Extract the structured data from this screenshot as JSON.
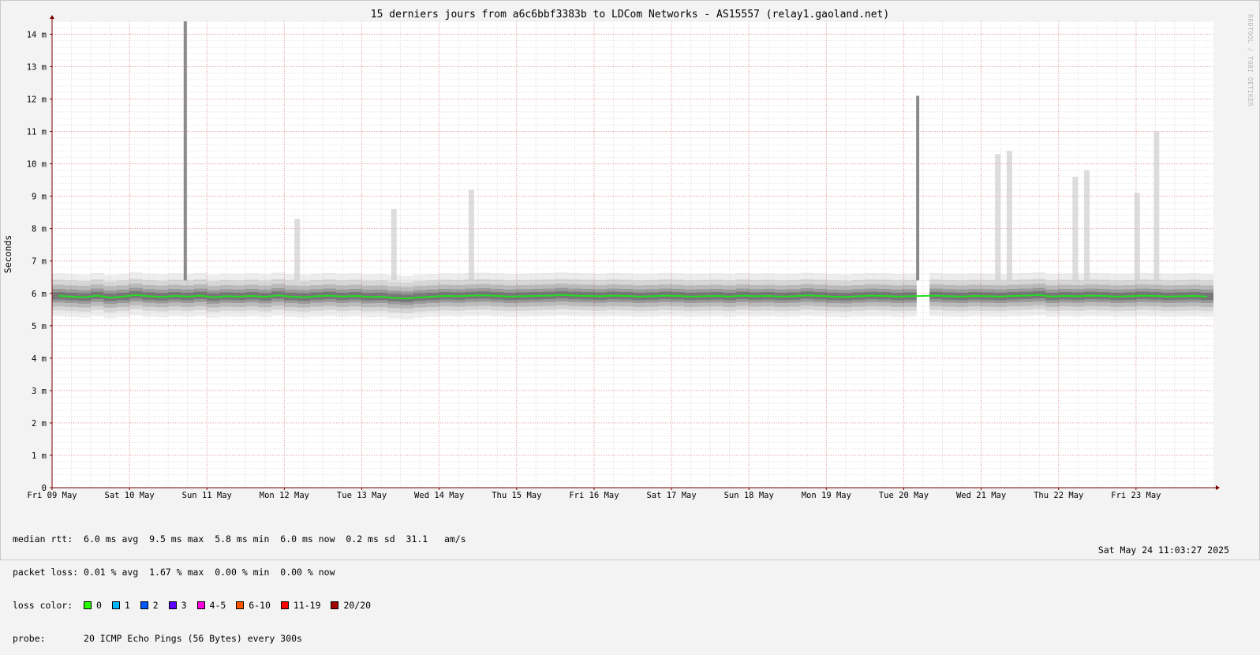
{
  "chart_data": {
    "type": "area",
    "title": "15 derniers jours from a6c6bbf3383b to LDCom Networks - AS15557 (relay1.gaoland.net)",
    "ylabel": "Seconds",
    "xlabel": "",
    "ylim": [
      0,
      14.4
    ],
    "y_unit_label": "ms",
    "y_ticks": [
      {
        "value": 0,
        "label": "0"
      },
      {
        "value": 1,
        "label": "1 m"
      },
      {
        "value": 2,
        "label": "2 m"
      },
      {
        "value": 3,
        "label": "3 m"
      },
      {
        "value": 4,
        "label": "4 m"
      },
      {
        "value": 5,
        "label": "5 m"
      },
      {
        "value": 6,
        "label": "6 m"
      },
      {
        "value": 7,
        "label": "7 m"
      },
      {
        "value": 8,
        "label": "8 m"
      },
      {
        "value": 9,
        "label": "9 m"
      },
      {
        "value": 10,
        "label": "10 m"
      },
      {
        "value": 11,
        "label": "11 m"
      },
      {
        "value": 12,
        "label": "12 m"
      },
      {
        "value": 13,
        "label": "13 m"
      },
      {
        "value": 14,
        "label": "14 m"
      }
    ],
    "x_range": [
      "2025-05-09",
      "2025-05-24 00:00"
    ],
    "x_ticks": [
      {
        "day": 0,
        "label": "Fri 09 May"
      },
      {
        "day": 1,
        "label": "Sat 10 May"
      },
      {
        "day": 2,
        "label": "Sun 11 May"
      },
      {
        "day": 3,
        "label": "Mon 12 May"
      },
      {
        "day": 4,
        "label": "Tue 13 May"
      },
      {
        "day": 5,
        "label": "Wed 14 May"
      },
      {
        "day": 6,
        "label": "Thu 15 May"
      },
      {
        "day": 7,
        "label": "Fri 16 May"
      },
      {
        "day": 8,
        "label": "Sat 17 May"
      },
      {
        "day": 9,
        "label": "Sun 18 May"
      },
      {
        "day": 10,
        "label": "Mon 19 May"
      },
      {
        "day": 11,
        "label": "Tue 20 May"
      },
      {
        "day": 12,
        "label": "Wed 21 May"
      },
      {
        "day": 13,
        "label": "Thu 22 May"
      },
      {
        "day": 14,
        "label": "Fri 23 May"
      }
    ],
    "series_name": "median rtt",
    "median_ms": [
      5.92,
      5.9,
      5.88,
      5.93,
      5.87,
      5.9,
      5.95,
      5.91,
      5.89,
      5.92,
      5.9,
      5.93,
      5.88,
      5.91,
      5.9,
      5.92,
      5.89,
      5.94,
      5.9,
      5.88,
      5.91,
      5.93,
      5.9,
      5.92,
      5.89,
      5.9,
      5.86,
      5.84,
      5.88,
      5.9,
      5.92,
      5.91,
      5.93,
      5.94,
      5.92,
      5.9,
      5.91,
      5.92,
      5.93,
      5.95,
      5.93,
      5.92,
      5.91,
      5.93,
      5.92,
      5.9,
      5.91,
      5.93,
      5.92,
      5.9,
      5.91,
      5.92,
      5.9,
      5.93,
      5.91,
      5.92,
      5.9,
      5.91,
      5.94,
      5.92,
      5.9,
      5.89,
      5.91,
      5.93,
      5.92,
      5.9,
      5.91,
      5.92,
      5.93,
      5.91,
      5.9,
      5.92,
      5.91,
      5.9,
      5.92,
      5.93,
      5.95,
      5.9,
      5.92,
      5.91,
      5.93,
      5.92,
      5.9,
      5.91,
      5.93,
      5.92,
      5.9,
      5.91,
      5.92,
      5.9
    ],
    "spikes_ms": [
      {
        "day": 1.72,
        "max": 14.4
      },
      {
        "day": 11.18,
        "max": 12.1
      },
      {
        "day": 5.4,
        "max": 9.2
      },
      {
        "day": 4.4,
        "max": 8.6
      },
      {
        "day": 3.15,
        "max": 8.3
      },
      {
        "day": 12.2,
        "max": 10.3
      },
      {
        "day": 12.35,
        "max": 10.4
      },
      {
        "day": 13.2,
        "max": 9.6
      },
      {
        "day": 13.35,
        "max": 9.8
      },
      {
        "day": 14.0,
        "max": 9.1
      },
      {
        "day": 14.25,
        "max": 11.0
      }
    ],
    "outage_day": 11.2,
    "colors": {
      "background": "#ffffff",
      "grid_minor": "#e6e6e6",
      "grid_major": "#f1a0a0",
      "axis": "#7a0000",
      "median": "#22dd22",
      "smoke": "#505050"
    }
  },
  "stats": {
    "median_rtt_label": "median rtt:",
    "median_rtt_text": "6.0 ms avg  9.5 ms max  5.8 ms min  6.0 ms now  0.2 ms sd  31.1   am/s",
    "packet_loss_label": "packet loss:",
    "packet_loss_text": "0.01 % avg  1.67 % max  0.00 % min  0.00 % now",
    "loss_color_label": "loss color:",
    "probe_label": "probe:",
    "probe_text": "20 ICMP Echo Pings (56 Bytes) every 300s",
    "timestamp": "Sat May 24 11:03:27 2025",
    "watermark": "RRDTOOL / TOBI OETIKER"
  },
  "loss_colors": [
    {
      "label": "0",
      "color": "#26ff00"
    },
    {
      "label": "1",
      "color": "#00b8ff"
    },
    {
      "label": "2",
      "color": "#0059ff"
    },
    {
      "label": "3",
      "color": "#5e00ff"
    },
    {
      "label": "4-5",
      "color": "#ff00dd"
    },
    {
      "label": "6-10",
      "color": "#ff5500"
    },
    {
      "label": "11-19",
      "color": "#ff0000"
    },
    {
      "label": "20/20",
      "color": "#a10000"
    }
  ]
}
